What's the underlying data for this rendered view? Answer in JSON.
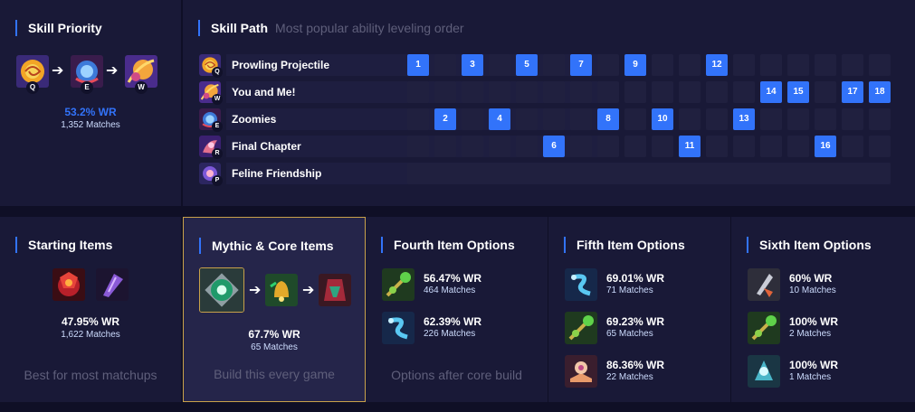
{
  "skill_priority": {
    "title": "Skill Priority",
    "order": [
      {
        "key": "Q",
        "icon": "prowling-projectile-icon"
      },
      {
        "key": "E",
        "icon": "zoomies-icon"
      },
      {
        "key": "W",
        "icon": "you-and-me-icon"
      }
    ],
    "win_rate": "53.2% WR",
    "matches": "1,352 Matches"
  },
  "skill_path": {
    "title": "Skill Path",
    "subtitle": "Most popular ability leveling order",
    "skills": [
      {
        "name": "Prowling Projectile",
        "key": "Q",
        "levels": [
          1,
          3,
          5,
          7,
          9,
          12
        ]
      },
      {
        "name": "You and Me!",
        "key": "W",
        "levels": [
          14,
          15,
          17,
          18
        ]
      },
      {
        "name": "Zoomies",
        "key": "E",
        "levels": [
          2,
          4,
          8,
          10,
          13
        ]
      },
      {
        "name": "Final Chapter",
        "key": "R",
        "levels": [
          6,
          11,
          16
        ]
      },
      {
        "name": "Feline Friendship",
        "key": "P",
        "levels": []
      }
    ]
  },
  "starting_items": {
    "title": "Starting Items",
    "items": [
      "red-crest-item-icon",
      "purple-shard-item-icon"
    ],
    "win_rate": "47.95% WR",
    "matches": "1,622 Matches",
    "footer": "Best for most matchups"
  },
  "core_items": {
    "title": "Mythic & Core Items",
    "items": [
      "eye-crest-item-icon",
      "golden-bell-item-icon",
      "red-cloak-item-icon"
    ],
    "win_rate": "67.7% WR",
    "matches": "65 Matches",
    "footer": "Build this every game"
  },
  "fourth_items": {
    "title": "Fourth Item Options",
    "options": [
      {
        "icon": "green-staff-item-icon",
        "win_rate": "56.47% WR",
        "matches": "464 Matches"
      },
      {
        "icon": "blue-serpent-item-icon",
        "win_rate": "62.39% WR",
        "matches": "226 Matches"
      }
    ],
    "footer": "Options after core build"
  },
  "fifth_items": {
    "title": "Fifth Item Options",
    "options": [
      {
        "icon": "blue-serpent-item-icon",
        "win_rate": "69.01% WR",
        "matches": "71 Matches"
      },
      {
        "icon": "green-staff-item-icon",
        "win_rate": "69.23% WR",
        "matches": "65 Matches"
      },
      {
        "icon": "pink-tome-item-icon",
        "win_rate": "86.36% WR",
        "matches": "22 Matches"
      }
    ]
  },
  "sixth_items": {
    "title": "Sixth Item Options",
    "options": [
      {
        "icon": "grey-blade-item-icon",
        "win_rate": "60% WR",
        "matches": "10 Matches"
      },
      {
        "icon": "green-staff-item-icon",
        "win_rate": "100% WR",
        "matches": "2 Matches"
      },
      {
        "icon": "cyan-spirit-item-icon",
        "win_rate": "100% WR",
        "matches": "1 Matches"
      }
    ]
  },
  "colors": {
    "accent": "#3273fa",
    "panel": "#191937",
    "highlight_border": "#c8a14a",
    "muted_text": "#5f5f7b"
  }
}
